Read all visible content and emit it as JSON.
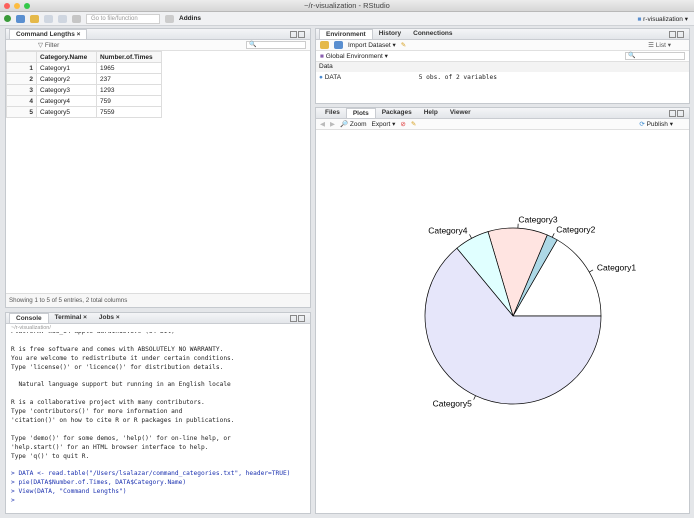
{
  "window": {
    "title": "~/r-visualization - RStudio"
  },
  "toolbar": {
    "goto_placeholder": "Go to file/function",
    "addins": "Addins",
    "project": "r-visualization"
  },
  "viewer": {
    "tab": "Command Lengths",
    "filter": "Filter",
    "columns": [
      "",
      "Category.Name",
      "Number.of.Times"
    ],
    "rows": [
      [
        "1",
        "Category1",
        "1965"
      ],
      [
        "2",
        "Category2",
        "237"
      ],
      [
        "3",
        "Category3",
        "1293"
      ],
      [
        "4",
        "Category4",
        "759"
      ],
      [
        "5",
        "Category5",
        "7559"
      ]
    ],
    "status": "Showing 1 to 5 of 5 entries, 2 total columns"
  },
  "console": {
    "tabs": [
      "Console",
      "Terminal",
      "Jobs"
    ],
    "path": "~/r-visualization/",
    "lines": [
      "Platform: x86_64-apple-darwin15.6.0 (64-bit)",
      "",
      "R is free software and comes with ABSOLUTELY NO WARRANTY.",
      "You are welcome to redistribute it under certain conditions.",
      "Type 'license()' or 'licence()' for distribution details.",
      "",
      "  Natural language support but running in an English locale",
      "",
      "R is a collaborative project with many contributors.",
      "Type 'contributors()' for more information and",
      "'citation()' on how to cite R or R packages in publications.",
      "",
      "Type 'demo()' for some demos, 'help()' for on-line help, or",
      "'help.start()' for an HTML browser interface to help.",
      "Type 'q()' to quit R.",
      ""
    ],
    "commands": [
      "> DATA <- read.table(\"/Users/lsalazar/command_categories.txt\", header=TRUE)",
      "> pie(DATA$Number.of.Times, DATA$Category.Name)",
      "> View(DATA, \"Command Lengths\")",
      "> "
    ]
  },
  "environment": {
    "tabs": [
      "Environment",
      "History",
      "Connections"
    ],
    "import": "Import Dataset",
    "list": "List",
    "scope": "Global Environment",
    "section": "Data",
    "var_name": "DATA",
    "var_value": "5 obs. of 2 variables"
  },
  "plots": {
    "tabs": [
      "Files",
      "Plots",
      "Packages",
      "Help",
      "Viewer"
    ],
    "zoom": "Zoom",
    "export": "Export",
    "publish": "Publish"
  },
  "chart_data": {
    "type": "pie",
    "categories": [
      "Category1",
      "Category2",
      "Category3",
      "Category4",
      "Category5"
    ],
    "values": [
      1965,
      237,
      1293,
      759,
      7559
    ],
    "colors": [
      "#ffffff",
      "#add8e6",
      "#ffe4e1",
      "#e0ffff",
      "#e6e6fa"
    ],
    "start_angle_deg": 0,
    "direction": "counterclockwise"
  }
}
